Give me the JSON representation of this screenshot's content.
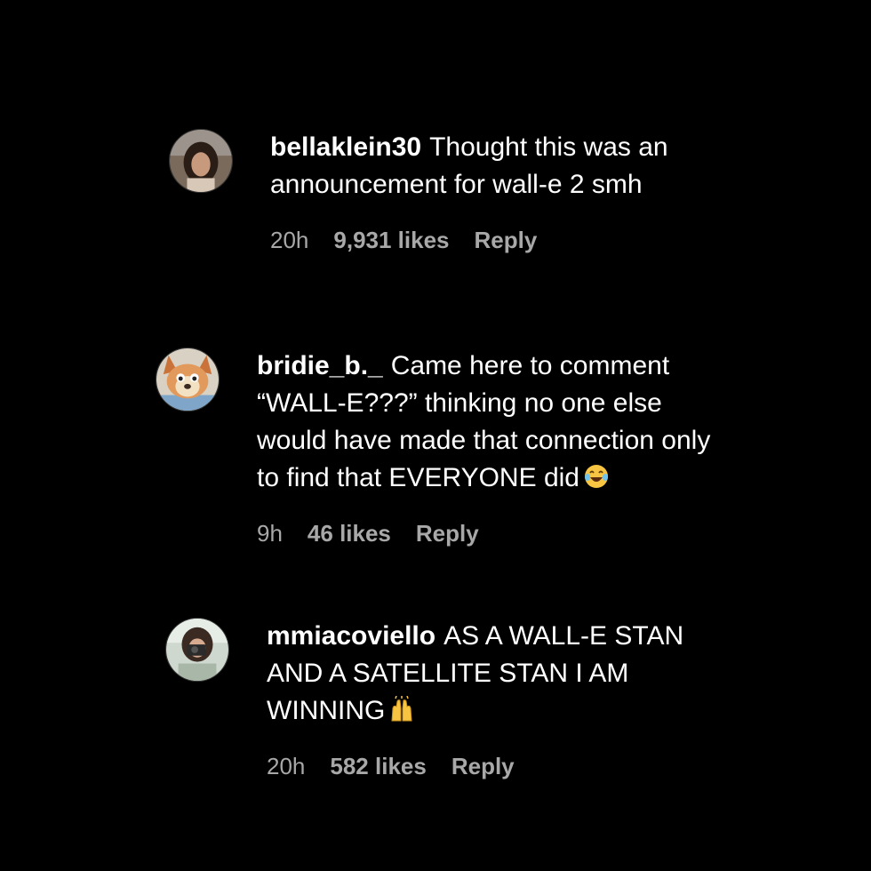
{
  "comments": [
    {
      "username": "bellaklein30",
      "text": "Thought this was an announcement for wall-e 2 smh",
      "time": "20h",
      "likes": "9,931 likes",
      "reply": "Reply",
      "avatar_icon": "profile-photo-icon"
    },
    {
      "username": "bridie_b._",
      "text": "Came here to comment “WALL-E???” thinking no one else would have made that connection only to find that EVERYONE did",
      "emoji": "face-with-tears-of-joy-icon",
      "time": "9h",
      "likes": "46 likes",
      "reply": "Reply",
      "avatar_icon": "cartoon-dog-avatar-icon"
    },
    {
      "username": "mmiacoviello",
      "text": "AS A WALL-E STAN AND A SATELLITE STAN I AM WINNING",
      "emoji": "raising-hands-icon",
      "time": "20h",
      "likes": "582 likes",
      "reply": "Reply",
      "avatar_icon": "profile-photo-camera-icon"
    }
  ],
  "colors": {
    "background": "#000000",
    "text": "#ffffff",
    "meta": "#a8a8a8"
  }
}
